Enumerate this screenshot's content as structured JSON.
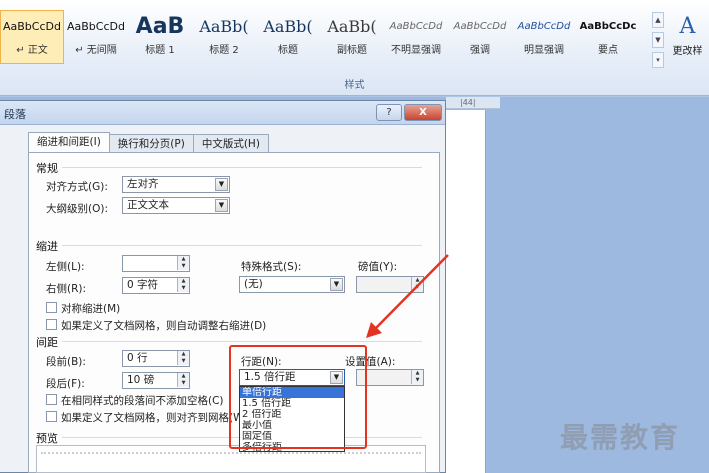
{
  "ribbon": {
    "styles": [
      {
        "preview": "AaBbCcDd",
        "label": "↵ 正文",
        "kind": "normal",
        "selected": true
      },
      {
        "preview": "AaBbCcDd",
        "label": "↵ 无间隔",
        "kind": "normal",
        "selected": false
      },
      {
        "preview": "AaB",
        "label": "标题 1",
        "kind": "big",
        "selected": false
      },
      {
        "preview": "AaBb(",
        "label": "标题 2",
        "kind": "mid",
        "selected": false
      },
      {
        "preview": "AaBb(",
        "label": "标题",
        "kind": "mid",
        "selected": false
      },
      {
        "preview": "AaBb(",
        "label": "副标题",
        "kind": "sub",
        "selected": false
      },
      {
        "preview": "AaBbCcDd",
        "label": "不明显强调",
        "kind": "it",
        "selected": false
      },
      {
        "preview": "AaBbCcDd",
        "label": "强调",
        "kind": "it",
        "selected": false
      },
      {
        "preview": "AaBbCcDd",
        "label": "明显强调",
        "kind": "itbl",
        "selected": false
      },
      {
        "preview": "AaBbCcDc",
        "label": "要点",
        "kind": "bold",
        "selected": false
      }
    ],
    "change_styles_label": "更改样",
    "group_label": "样式"
  },
  "ruler": {
    "text": "|44|"
  },
  "dialog": {
    "title": "段落",
    "help_label": "?",
    "close_label": "X",
    "tabs": [
      "缩进和间距(I)",
      "换行和分页(P)",
      "中文版式(H)"
    ],
    "general": {
      "heading": "常规",
      "alignment_label": "对齐方式(G):",
      "alignment_value": "左对齐",
      "outline_label": "大纲级别(O):",
      "outline_value": "正文文本"
    },
    "indent": {
      "heading": "缩进",
      "left_label": "左侧(L):",
      "left_value": "",
      "right_label": "右侧(R):",
      "right_value": "0 字符",
      "special_label": "特殊格式(S):",
      "special_value": "(无)",
      "by_label": "磅值(Y):",
      "by_value": "",
      "mirror_label": "对称缩进(M)",
      "auto_adjust_label": "如果定义了文档网格，则自动调整右缩进(D)"
    },
    "spacing": {
      "heading": "间距",
      "before_label": "段前(B):",
      "before_value": "0 行",
      "after_label": "段后(F):",
      "after_value": "10 磅",
      "line_spacing_label": "行距(N):",
      "line_spacing_value": "1.5 倍行距",
      "at_label": "设置值(A):",
      "at_value": "",
      "no_space_label": "在相同样式的段落间不添加空格(C)",
      "snap_grid_label": "如果定义了文档网格，则对齐到网格(W)"
    },
    "line_spacing_options": [
      "单倍行距",
      "1.5 倍行距",
      "2 倍行距",
      "最小值",
      "固定值",
      "多倍行距"
    ],
    "line_spacing_highlight": "单倍行距",
    "preview": {
      "heading": "预览"
    }
  },
  "watermark": "最需教育",
  "colors": {
    "annotation": "#e53322",
    "highlight": "#3874d8"
  }
}
